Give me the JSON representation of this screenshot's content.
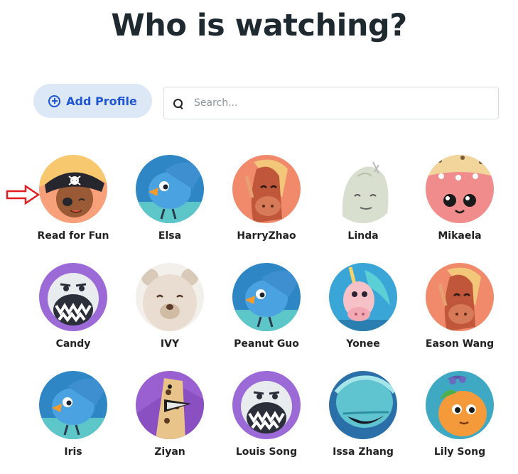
{
  "title": "Who is watching?",
  "add_profile": {
    "label": "Add Profile",
    "icon": "plus-circle-icon"
  },
  "search": {
    "placeholder": "Search...",
    "value": "",
    "icon": "search-icon"
  },
  "indicator": {
    "icon": "red-arrow-right-icon",
    "color": "#e02020"
  },
  "profiles": [
    {
      "name": "Read for Fun",
      "avatar": "pirate-kid"
    },
    {
      "name": "Elsa",
      "avatar": "blue-bird"
    },
    {
      "name": "HarryZhao",
      "avatar": "horse"
    },
    {
      "name": "Linda",
      "avatar": "ghost"
    },
    {
      "name": "Mikaela",
      "avatar": "pink-cookie"
    },
    {
      "name": "Candy",
      "avatar": "yeti"
    },
    {
      "name": "IVY",
      "avatar": "polar-bear"
    },
    {
      "name": "Peanut Guo",
      "avatar": "blue-bird"
    },
    {
      "name": "Yonee",
      "avatar": "unicorn"
    },
    {
      "name": "Eason Wang",
      "avatar": "horse"
    },
    {
      "name": "Iris",
      "avatar": "blue-bird"
    },
    {
      "name": "Ziyan",
      "avatar": "giraffe"
    },
    {
      "name": "Louis Song",
      "avatar": "yeti"
    },
    {
      "name": "Issa Zhang",
      "avatar": "teal-fish"
    },
    {
      "name": "Lily Song",
      "avatar": "orange-fruit"
    }
  ]
}
